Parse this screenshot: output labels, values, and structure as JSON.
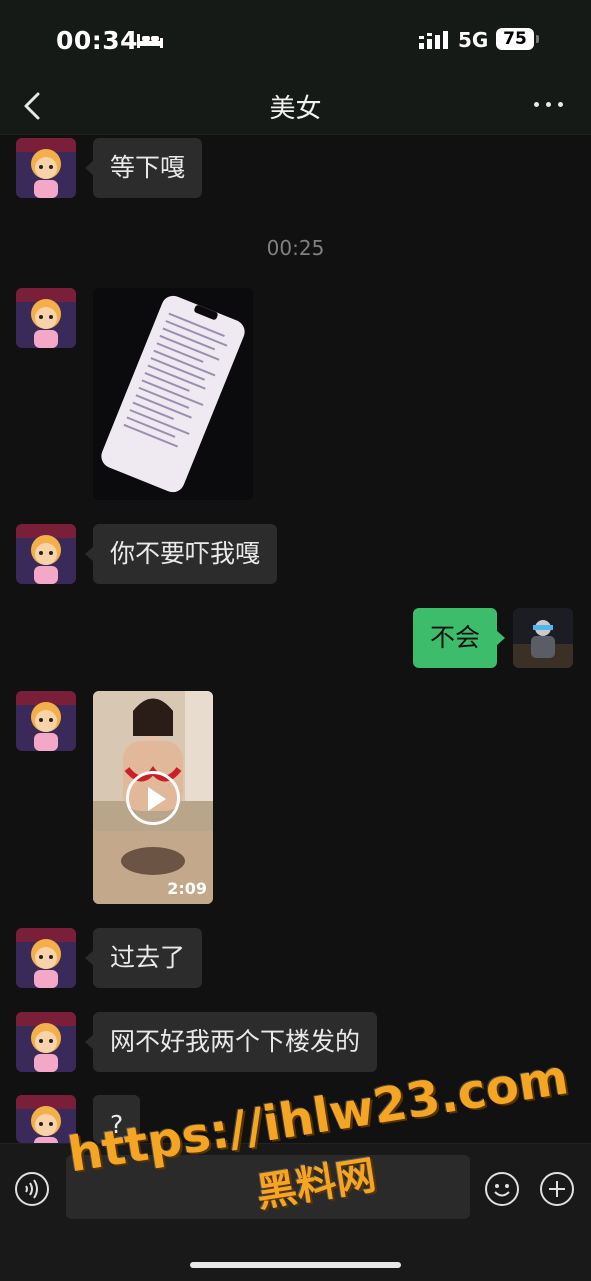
{
  "status_bar": {
    "time": "00:34",
    "network": "5G",
    "battery": "75"
  },
  "nav": {
    "title": "美女"
  },
  "messages": [
    {
      "type": "text",
      "side": "in",
      "text": "等下嘎"
    },
    {
      "type": "time",
      "text": "00:25"
    },
    {
      "type": "image",
      "side": "in"
    },
    {
      "type": "text",
      "side": "in",
      "text": "你不要吓我嘎"
    },
    {
      "type": "text",
      "side": "out",
      "text": "不会"
    },
    {
      "type": "video",
      "side": "in",
      "duration": "2:09"
    },
    {
      "type": "text",
      "side": "in",
      "text": "过去了"
    },
    {
      "type": "text",
      "side": "in",
      "text": "网不好我两个下楼发的"
    },
    {
      "type": "text",
      "side": "in",
      "text": "?"
    }
  ],
  "input_bar": {
    "value": ""
  },
  "watermark": {
    "url": "https://ihlw23.com",
    "text": "黑料网"
  },
  "colors": {
    "background": "#111111",
    "incoming_bubble": "#2c2c2c",
    "outgoing_bubble": "#3dbd6b",
    "watermark": "#f4a523"
  },
  "icons": [
    "bed-icon",
    "signal-icon",
    "chevron-left-icon",
    "more-icon",
    "voice-icon",
    "emoji-icon",
    "plus-icon",
    "play-icon"
  ]
}
